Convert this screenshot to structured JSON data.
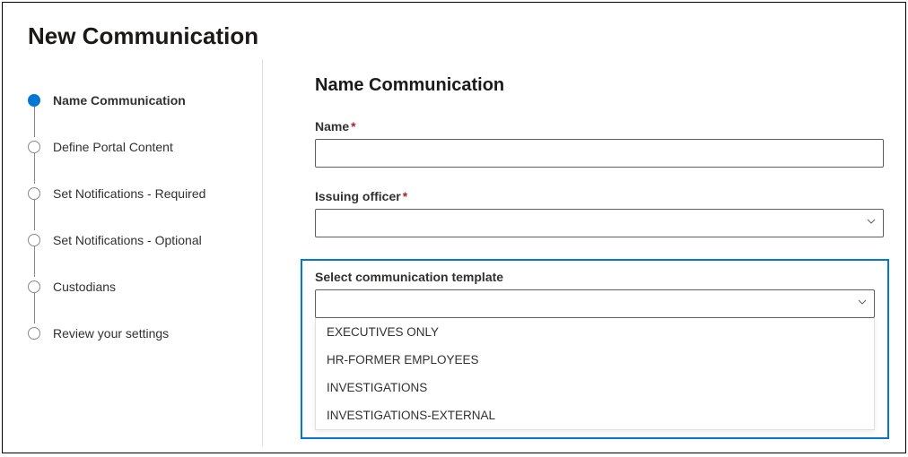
{
  "page_title": "New Communication",
  "steps": [
    {
      "label": "Name Communication",
      "active": true
    },
    {
      "label": "Define Portal Content",
      "active": false
    },
    {
      "label": "Set Notifications - Required",
      "active": false
    },
    {
      "label": "Set Notifications - Optional",
      "active": false
    },
    {
      "label": "Custodians",
      "active": false
    },
    {
      "label": "Review your settings",
      "active": false
    }
  ],
  "section_title": "Name Communication",
  "fields": {
    "name_label": "Name",
    "officer_label": "Issuing officer",
    "template_label": "Select communication template"
  },
  "template_options": [
    "EXECUTIVES ONLY",
    "HR-FORMER EMPLOYEES",
    "INVESTIGATIONS",
    "INVESTIGATIONS-EXTERNAL"
  ],
  "required_marker": "*"
}
